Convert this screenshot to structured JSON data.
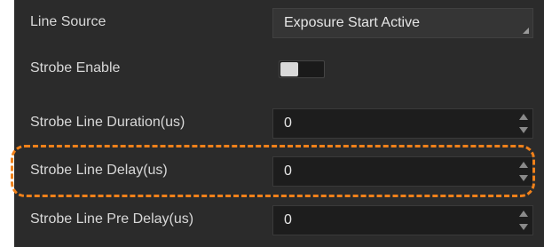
{
  "rows": [
    {
      "label": "Line Source",
      "value": "Exposure Start Active",
      "kind": "select"
    },
    {
      "label": "Strobe Enable",
      "kind": "toggle",
      "toggle_on": false
    },
    {
      "label": "Strobe Line Duration(us)",
      "value": "0",
      "kind": "spinbox"
    },
    {
      "label": "Strobe Line Delay(us)",
      "value": "0",
      "kind": "spinbox",
      "highlighted": true
    },
    {
      "label": "Strobe Line Pre Delay(us)",
      "value": "0",
      "kind": "spinbox"
    }
  ],
  "colors": {
    "panel_bg": "#2b2b2b",
    "field_bg": "#1d1d1d",
    "text": "#d8d8d8",
    "highlight_outline": "#f0811a"
  },
  "icons": {
    "select_caret": "dropdown-corner-icon",
    "spin_up": "spin-up-arrow-icon",
    "spin_down": "spin-down-arrow-icon"
  }
}
